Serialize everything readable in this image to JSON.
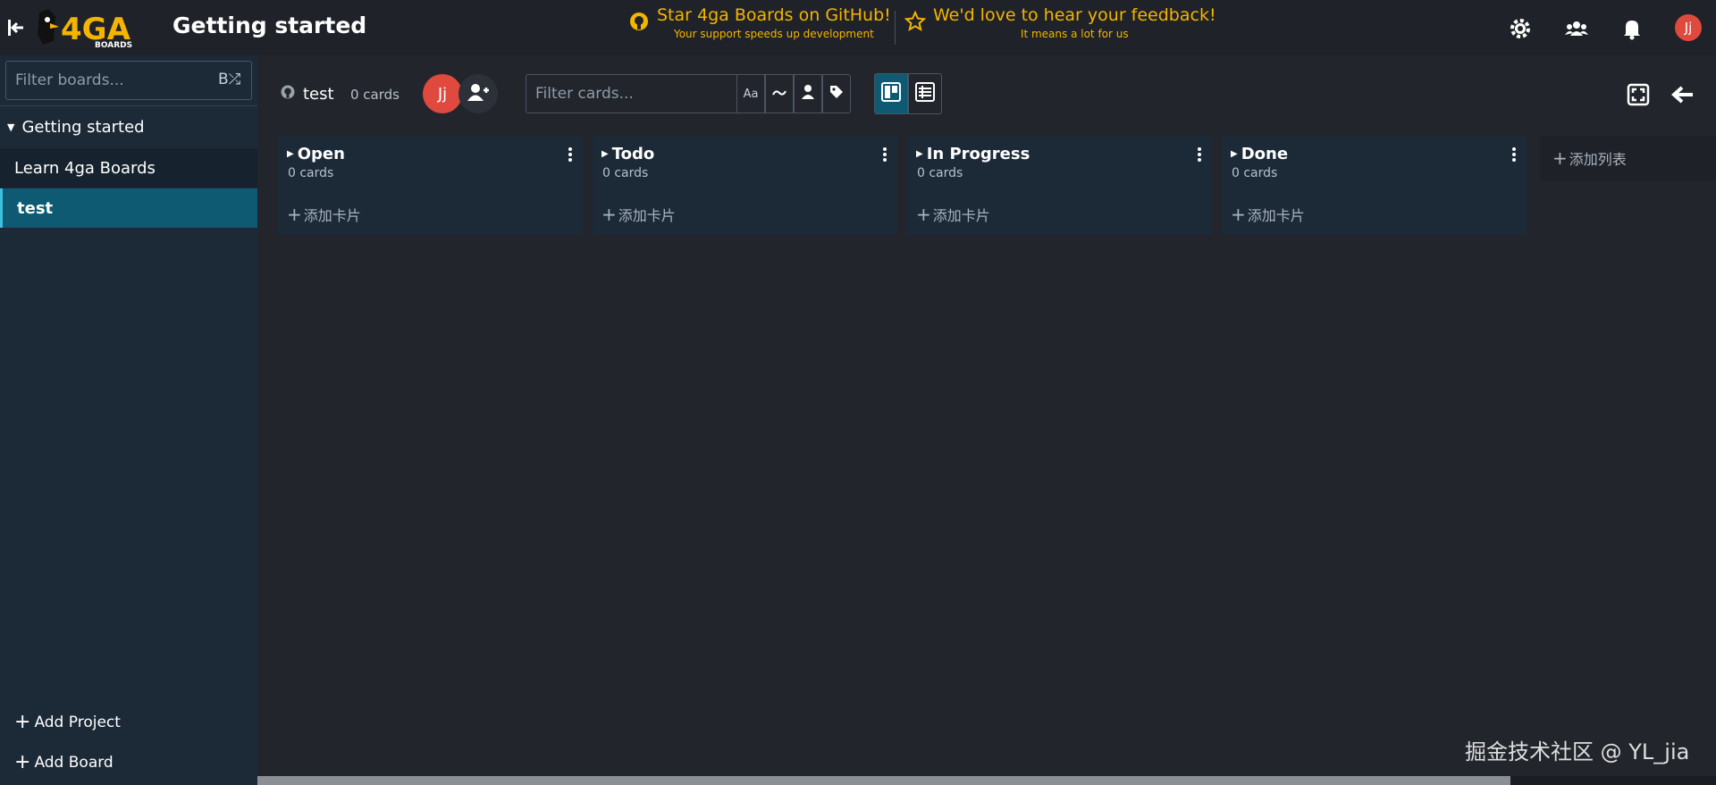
{
  "header": {
    "app_title": "Getting started",
    "promo_github_title": "Star 4ga Boards on GitHub!",
    "promo_github_sub": "Your support speeds up development",
    "promo_feedback_title": "We'd love to hear your feedback!",
    "promo_feedback_sub": "It means a lot for us",
    "user_initials": "Jj",
    "icons": [
      "collapse-sidebar-icon",
      "github-icon",
      "star-icon",
      "settings-icon",
      "users-icon",
      "bell-icon"
    ]
  },
  "sidebar": {
    "filter_placeholder": "Filter boards...",
    "filter_shuffle": "B⤮",
    "project": "Getting started",
    "boards": [
      "Learn 4ga Boards",
      "test"
    ],
    "add_project": "Add Project",
    "add_board": "Add Board"
  },
  "board": {
    "name": "test",
    "card_count": "0 cards",
    "member_initials": "Jj",
    "filter_cards_placeholder": "Filter cards...",
    "filter_text_label": "Aa"
  },
  "lists": [
    {
      "title": "Open",
      "count": "0 cards",
      "add_card": "添加卡片"
    },
    {
      "title": "Todo",
      "count": "0 cards",
      "add_card": "添加卡片"
    },
    {
      "title": "In Progress",
      "count": "0 cards",
      "add_card": "添加卡片"
    },
    {
      "title": "Done",
      "count": "0 cards",
      "add_card": "添加卡片"
    }
  ],
  "add_list": "添加列表",
  "watermark": "掘金技术社区 @ YL_jia",
  "colors": {
    "accent": "#f5b400",
    "avatar": "#e0493e",
    "active_board": "#0d5a72",
    "sidebar_bg": "#1c2936",
    "list_bg": "#1c2a38",
    "page_bg": "#22252b"
  }
}
